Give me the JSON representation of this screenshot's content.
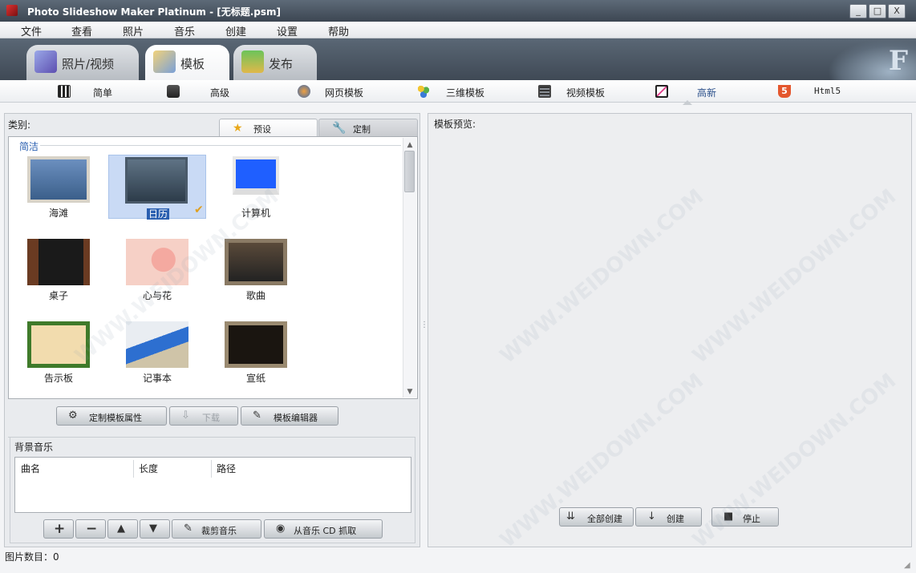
{
  "window": {
    "title": "Photo Slideshow Maker Platinum - [无标题.psm]",
    "controls": {
      "minimize": "_",
      "maximize": "□",
      "close": "X"
    }
  },
  "menu": [
    "文件",
    "查看",
    "照片",
    "音乐",
    "创建",
    "设置",
    "帮助"
  ],
  "main_tabs": [
    {
      "label": "照片/视频",
      "icon": "photo-video-icon",
      "active": false
    },
    {
      "label": "模板",
      "icon": "template-icon",
      "active": true
    },
    {
      "label": "发布",
      "icon": "publish-icon",
      "active": false
    }
  ],
  "sub_tabs": [
    {
      "label": "简单",
      "icon": "piano-icon"
    },
    {
      "label": "高级",
      "icon": "toolbox-icon"
    },
    {
      "label": "网页模板",
      "icon": "web-template-icon"
    },
    {
      "label": "三维模板",
      "icon": "3d-template-icon"
    },
    {
      "label": "视频模板",
      "icon": "film-icon"
    },
    {
      "label": "高新",
      "icon": "hd-icon",
      "active": true
    },
    {
      "label": "Html5",
      "icon": "html5-icon"
    }
  ],
  "left_panel": {
    "category_label": "类别:",
    "tabs": [
      {
        "label": "预设",
        "icon": "star-icon",
        "active": true
      },
      {
        "label": "定制",
        "icon": "wrench-icon",
        "active": false
      }
    ],
    "group_label": "简洁",
    "templates": [
      {
        "name": "海滩",
        "selected": false
      },
      {
        "name": "日历",
        "selected": true
      },
      {
        "name": "计算机",
        "selected": false
      },
      {
        "name": "桌子",
        "selected": false
      },
      {
        "name": "心与花",
        "selected": false
      },
      {
        "name": "歌曲",
        "selected": false
      },
      {
        "name": "告示板",
        "selected": false
      },
      {
        "name": "记事本",
        "selected": false
      },
      {
        "name": "宣纸",
        "selected": false
      }
    ],
    "buttons": {
      "customize": "定制模板属性",
      "download": "下载",
      "editor": "模板编辑器"
    }
  },
  "music": {
    "label": "背景音乐",
    "columns": [
      "曲名",
      "长度",
      "路径"
    ],
    "buttons": {
      "add": "+",
      "remove": "−",
      "up": "▲",
      "down": "▼",
      "trim": "裁剪音乐",
      "rip": "从音乐 CD 抓取"
    }
  },
  "preview": {
    "label": "模板预览:",
    "buttons": {
      "create_all": "全部创建",
      "create": "创建",
      "stop": "停止"
    }
  },
  "status": {
    "photo_count": "图片数目：0"
  },
  "watermark": "WWW.WEIDOWN.COM",
  "colors": {
    "titlebar": "#4a5563",
    "selected_bg": "#c9daf5",
    "group_text": "#2a5fb0"
  }
}
